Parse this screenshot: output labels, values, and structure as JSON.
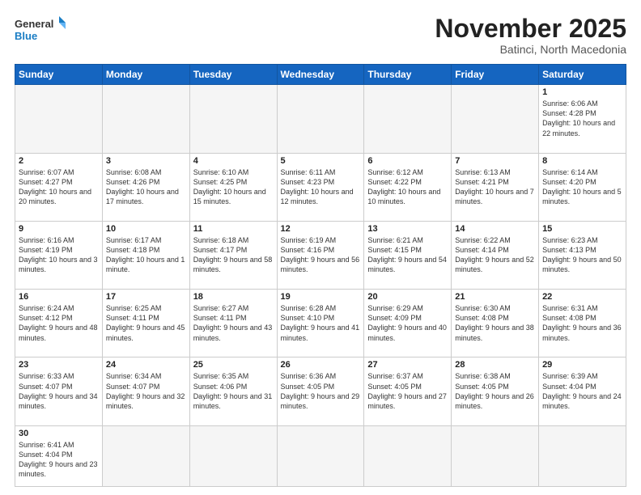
{
  "header": {
    "logo_general": "General",
    "logo_blue": "Blue",
    "month_title": "November 2025",
    "location": "Batinci, North Macedonia"
  },
  "weekdays": [
    "Sunday",
    "Monday",
    "Tuesday",
    "Wednesday",
    "Thursday",
    "Friday",
    "Saturday"
  ],
  "weeks": [
    [
      {
        "day": "",
        "info": ""
      },
      {
        "day": "",
        "info": ""
      },
      {
        "day": "",
        "info": ""
      },
      {
        "day": "",
        "info": ""
      },
      {
        "day": "",
        "info": ""
      },
      {
        "day": "",
        "info": ""
      },
      {
        "day": "1",
        "info": "Sunrise: 6:06 AM\nSunset: 4:28 PM\nDaylight: 10 hours and 22 minutes."
      }
    ],
    [
      {
        "day": "2",
        "info": "Sunrise: 6:07 AM\nSunset: 4:27 PM\nDaylight: 10 hours and 20 minutes."
      },
      {
        "day": "3",
        "info": "Sunrise: 6:08 AM\nSunset: 4:26 PM\nDaylight: 10 hours and 17 minutes."
      },
      {
        "day": "4",
        "info": "Sunrise: 6:10 AM\nSunset: 4:25 PM\nDaylight: 10 hours and 15 minutes."
      },
      {
        "day": "5",
        "info": "Sunrise: 6:11 AM\nSunset: 4:23 PM\nDaylight: 10 hours and 12 minutes."
      },
      {
        "day": "6",
        "info": "Sunrise: 6:12 AM\nSunset: 4:22 PM\nDaylight: 10 hours and 10 minutes."
      },
      {
        "day": "7",
        "info": "Sunrise: 6:13 AM\nSunset: 4:21 PM\nDaylight: 10 hours and 7 minutes."
      },
      {
        "day": "8",
        "info": "Sunrise: 6:14 AM\nSunset: 4:20 PM\nDaylight: 10 hours and 5 minutes."
      }
    ],
    [
      {
        "day": "9",
        "info": "Sunrise: 6:16 AM\nSunset: 4:19 PM\nDaylight: 10 hours and 3 minutes."
      },
      {
        "day": "10",
        "info": "Sunrise: 6:17 AM\nSunset: 4:18 PM\nDaylight: 10 hours and 1 minute."
      },
      {
        "day": "11",
        "info": "Sunrise: 6:18 AM\nSunset: 4:17 PM\nDaylight: 9 hours and 58 minutes."
      },
      {
        "day": "12",
        "info": "Sunrise: 6:19 AM\nSunset: 4:16 PM\nDaylight: 9 hours and 56 minutes."
      },
      {
        "day": "13",
        "info": "Sunrise: 6:21 AM\nSunset: 4:15 PM\nDaylight: 9 hours and 54 minutes."
      },
      {
        "day": "14",
        "info": "Sunrise: 6:22 AM\nSunset: 4:14 PM\nDaylight: 9 hours and 52 minutes."
      },
      {
        "day": "15",
        "info": "Sunrise: 6:23 AM\nSunset: 4:13 PM\nDaylight: 9 hours and 50 minutes."
      }
    ],
    [
      {
        "day": "16",
        "info": "Sunrise: 6:24 AM\nSunset: 4:12 PM\nDaylight: 9 hours and 48 minutes."
      },
      {
        "day": "17",
        "info": "Sunrise: 6:25 AM\nSunset: 4:11 PM\nDaylight: 9 hours and 45 minutes."
      },
      {
        "day": "18",
        "info": "Sunrise: 6:27 AM\nSunset: 4:11 PM\nDaylight: 9 hours and 43 minutes."
      },
      {
        "day": "19",
        "info": "Sunrise: 6:28 AM\nSunset: 4:10 PM\nDaylight: 9 hours and 41 minutes."
      },
      {
        "day": "20",
        "info": "Sunrise: 6:29 AM\nSunset: 4:09 PM\nDaylight: 9 hours and 40 minutes."
      },
      {
        "day": "21",
        "info": "Sunrise: 6:30 AM\nSunset: 4:08 PM\nDaylight: 9 hours and 38 minutes."
      },
      {
        "day": "22",
        "info": "Sunrise: 6:31 AM\nSunset: 4:08 PM\nDaylight: 9 hours and 36 minutes."
      }
    ],
    [
      {
        "day": "23",
        "info": "Sunrise: 6:33 AM\nSunset: 4:07 PM\nDaylight: 9 hours and 34 minutes."
      },
      {
        "day": "24",
        "info": "Sunrise: 6:34 AM\nSunset: 4:07 PM\nDaylight: 9 hours and 32 minutes."
      },
      {
        "day": "25",
        "info": "Sunrise: 6:35 AM\nSunset: 4:06 PM\nDaylight: 9 hours and 31 minutes."
      },
      {
        "day": "26",
        "info": "Sunrise: 6:36 AM\nSunset: 4:05 PM\nDaylight: 9 hours and 29 minutes."
      },
      {
        "day": "27",
        "info": "Sunrise: 6:37 AM\nSunset: 4:05 PM\nDaylight: 9 hours and 27 minutes."
      },
      {
        "day": "28",
        "info": "Sunrise: 6:38 AM\nSunset: 4:05 PM\nDaylight: 9 hours and 26 minutes."
      },
      {
        "day": "29",
        "info": "Sunrise: 6:39 AM\nSunset: 4:04 PM\nDaylight: 9 hours and 24 minutes."
      }
    ],
    [
      {
        "day": "30",
        "info": "Sunrise: 6:41 AM\nSunset: 4:04 PM\nDaylight: 9 hours and 23 minutes."
      },
      {
        "day": "",
        "info": ""
      },
      {
        "day": "",
        "info": ""
      },
      {
        "day": "",
        "info": ""
      },
      {
        "day": "",
        "info": ""
      },
      {
        "day": "",
        "info": ""
      },
      {
        "day": "",
        "info": ""
      }
    ]
  ]
}
